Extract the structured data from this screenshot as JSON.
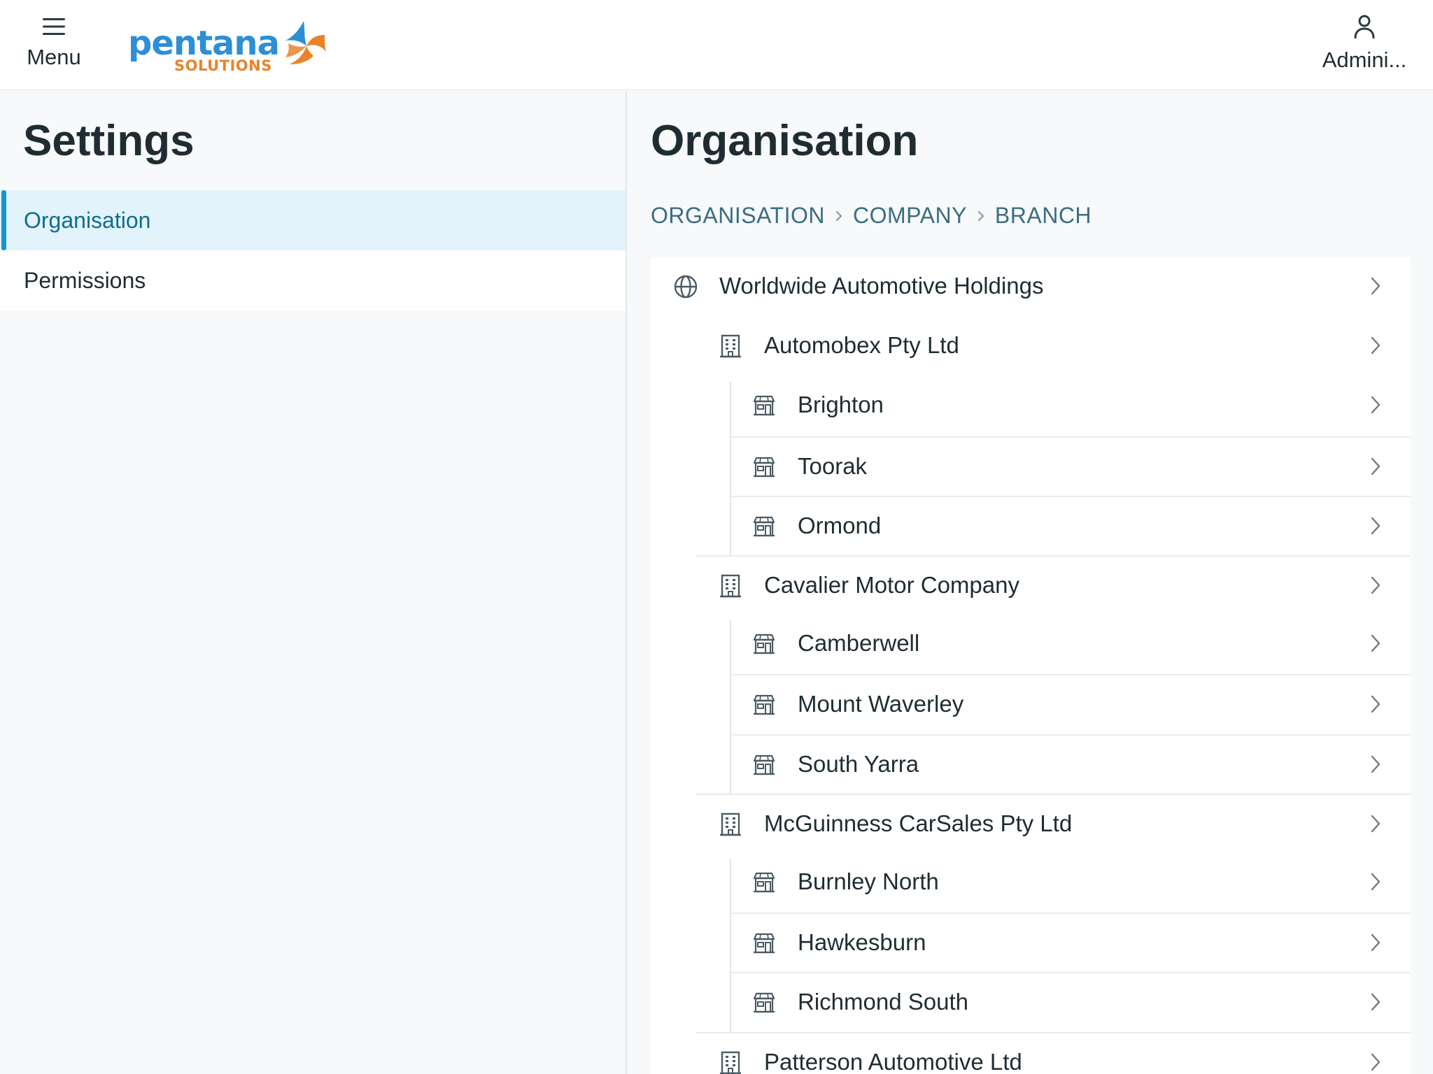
{
  "header": {
    "menu_label": "Menu",
    "logo_main": "pentana",
    "logo_sub": "SOLUTIONS",
    "user_label": "Admini..."
  },
  "sidebar": {
    "title": "Settings",
    "items": [
      {
        "label": "Organisation",
        "active": true
      },
      {
        "label": "Permissions",
        "active": false
      }
    ]
  },
  "main": {
    "title": "Organisation",
    "breadcrumb": [
      "ORGANISATION",
      "COMPANY",
      "BRANCH"
    ],
    "tree": {
      "root": "Worldwide Automotive Holdings",
      "companies": [
        {
          "name": "Automobex Pty Ltd",
          "branches": [
            "Brighton",
            "Toorak",
            "Ormond"
          ]
        },
        {
          "name": "Cavalier Motor Company",
          "branches": [
            "Camberwell",
            "Mount Waverley",
            "South Yarra"
          ]
        },
        {
          "name": "McGuinness CarSales Pty Ltd",
          "branches": [
            "Burnley North",
            "Hawkesburn",
            "Richmond South"
          ]
        },
        {
          "name": "Patterson Automotive Ltd",
          "branches": []
        }
      ]
    }
  },
  "colors": {
    "accent": "#1a96cf",
    "active_bg": "#e3f3fb",
    "breadcrumb": "#3c6d80",
    "logo_blue": "#2d8fd5",
    "logo_orange": "#e8832a"
  },
  "icons": {
    "menu": "hamburger-icon",
    "user": "user-icon",
    "root": "globe-icon",
    "company": "building-icon",
    "branch": "store-icon",
    "row_action": "chevron-right-icon",
    "breadcrumb_sep": "chevron-right-icon"
  }
}
